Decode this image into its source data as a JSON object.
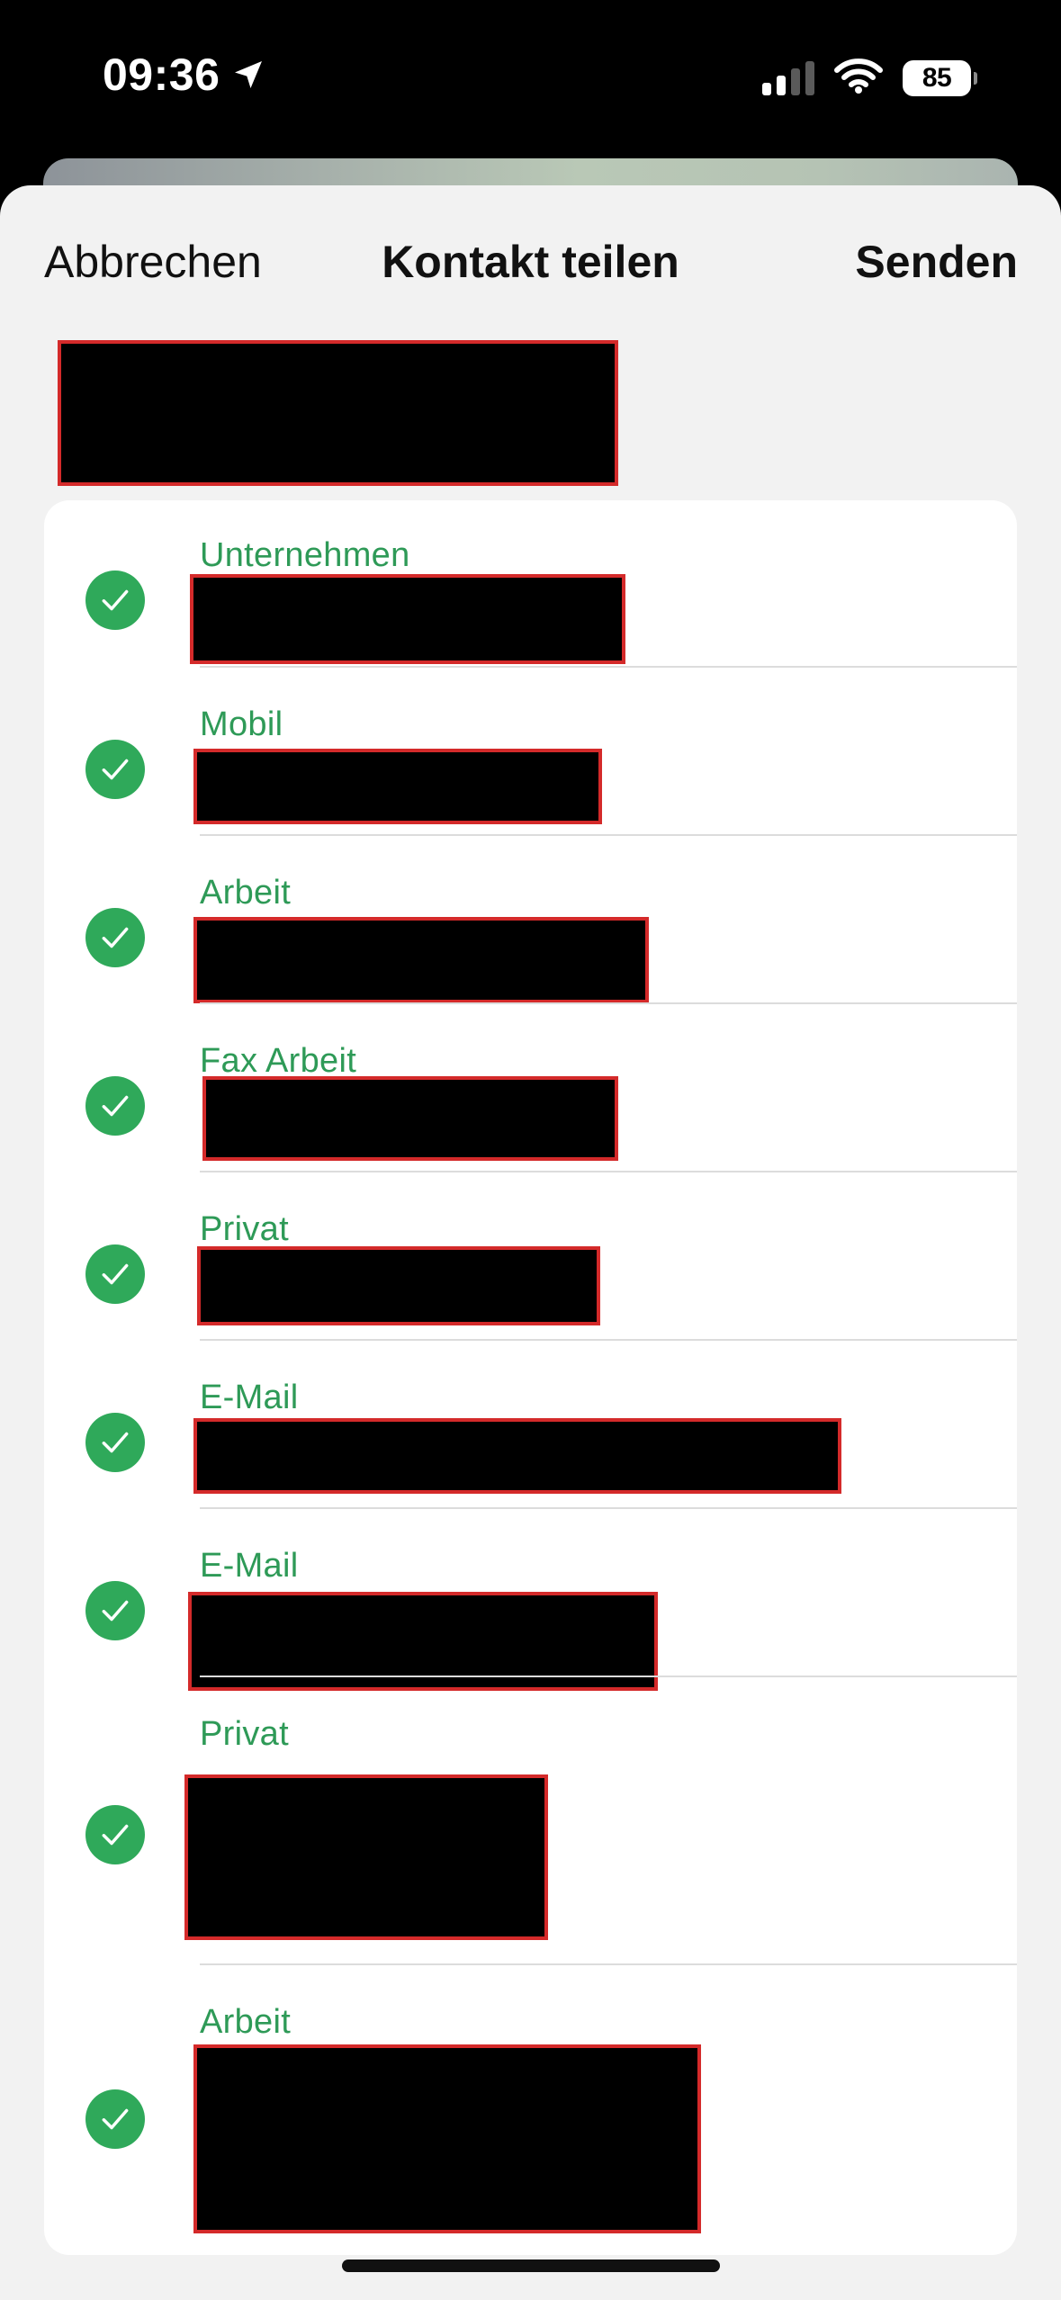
{
  "status_bar": {
    "time": "09:36",
    "battery": "85",
    "icons": [
      "location-arrow-icon",
      "cellular-signal-icon",
      "wifi-icon",
      "battery-icon"
    ]
  },
  "nav": {
    "cancel_label": "Abbrechen",
    "title": "Kontakt teilen",
    "send_label": "Senden"
  },
  "fields": [
    {
      "label": "Unternehmen",
      "selected": true
    },
    {
      "label": "Mobil",
      "selected": true
    },
    {
      "label": "Arbeit",
      "selected": true
    },
    {
      "label": "Fax Arbeit",
      "selected": true
    },
    {
      "label": "Privat",
      "selected": true
    },
    {
      "label": "E-Mail",
      "selected": true
    },
    {
      "label": "E-Mail",
      "selected": true
    },
    {
      "label": "Privat",
      "selected": true
    },
    {
      "label": "Arbeit",
      "selected": true
    }
  ],
  "colors": {
    "accent_green": "#2fa95a",
    "label_green": "#2e9a57",
    "sheet_background": "#f2f2f2",
    "redaction_outline": "#d42a2a"
  }
}
